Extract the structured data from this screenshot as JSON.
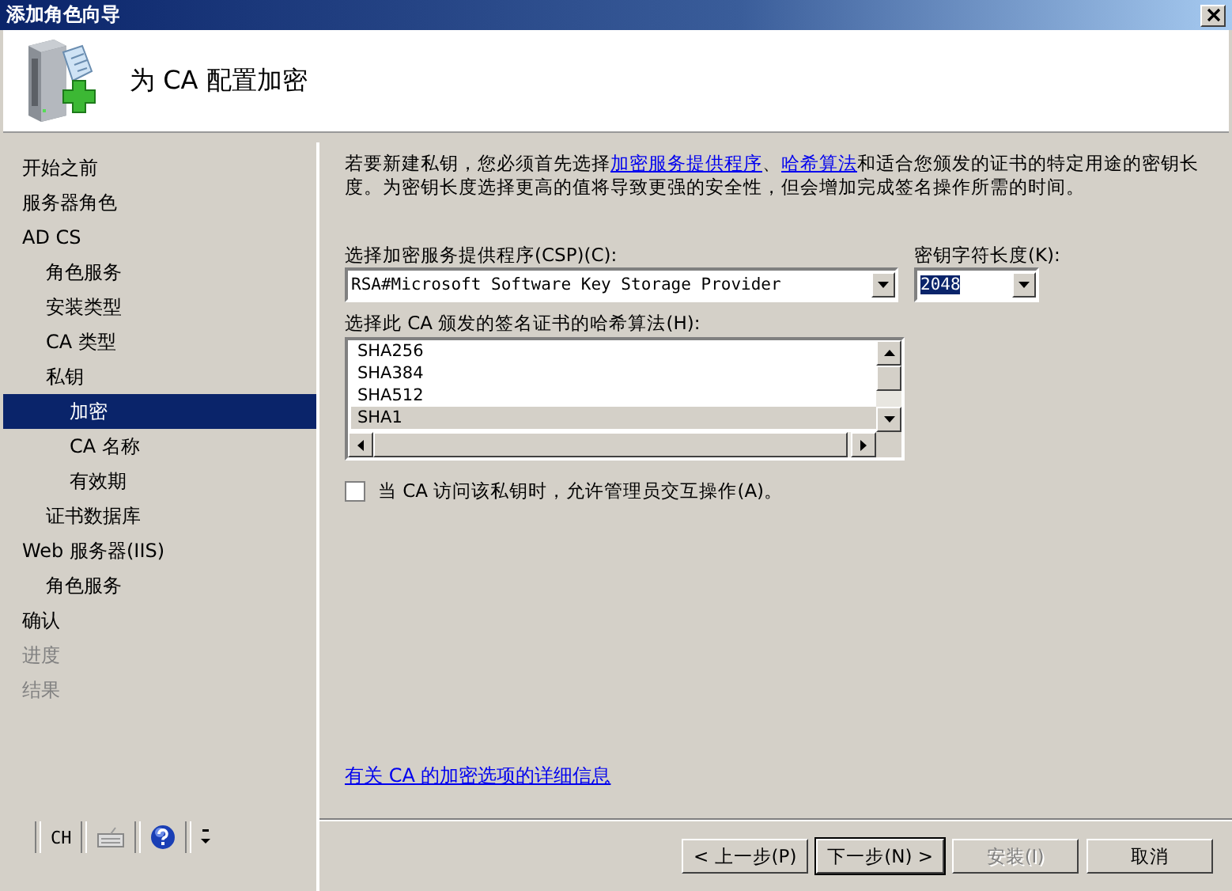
{
  "window": {
    "title": "添加角色向导"
  },
  "header": {
    "title": "为 CA 配置加密"
  },
  "sidebar": {
    "items": [
      {
        "label": "开始之前",
        "selected": false,
        "disabled": false
      },
      {
        "label": "服务器角色",
        "selected": false,
        "disabled": false
      },
      {
        "label": "AD CS",
        "selected": false,
        "disabled": false,
        "children": [
          {
            "label": "角色服务",
            "selected": false,
            "disabled": false
          },
          {
            "label": "安装类型",
            "selected": false,
            "disabled": false
          },
          {
            "label": "CA 类型",
            "selected": false,
            "disabled": false
          },
          {
            "label": "私钥",
            "selected": false,
            "disabled": false,
            "children": [
              {
                "label": "加密",
                "selected": true,
                "disabled": false
              },
              {
                "label": "CA 名称",
                "selected": false,
                "disabled": false
              },
              {
                "label": "有效期",
                "selected": false,
                "disabled": false
              }
            ]
          },
          {
            "label": "证书数据库",
            "selected": false,
            "disabled": false
          }
        ]
      },
      {
        "label": "Web 服务器(IIS)",
        "selected": false,
        "disabled": false,
        "children": [
          {
            "label": "角色服务",
            "selected": false,
            "disabled": false
          }
        ]
      },
      {
        "label": "确认",
        "selected": false,
        "disabled": false
      },
      {
        "label": "进度",
        "selected": false,
        "disabled": true
      },
      {
        "label": "结果",
        "selected": false,
        "disabled": true
      }
    ]
  },
  "intro": [
    {
      "kind": "text",
      "text": "若要新建私钥，您必须首先选择"
    },
    {
      "kind": "link",
      "text": "加密服务提供程序"
    },
    {
      "kind": "text",
      "text": "、"
    },
    {
      "kind": "link",
      "text": "哈希算法"
    },
    {
      "kind": "text",
      "text": "和适合您颁发的证书的特定用途的密钥长度。为密钥长度选择更高的值将导致更强的安全性，但会增加完成签名操作所需的时间。"
    }
  ],
  "csp": {
    "label": "选择加密服务提供程序(CSP)(C):",
    "value": "RSA#Microsoft Software Key Storage Provider"
  },
  "key_length": {
    "label": "密钥字符长度(K):",
    "value": "2048"
  },
  "hash": {
    "label": "选择此 CA 颁发的签名证书的哈希算法(H):",
    "items": [
      {
        "label": "SHA256",
        "selected": false
      },
      {
        "label": "SHA384",
        "selected": false
      },
      {
        "label": "SHA512",
        "selected": false
      },
      {
        "label": "SHA1",
        "selected": true
      }
    ]
  },
  "admin_interaction": {
    "label": "当 CA 访问该私钥时，允许管理员交互操作(A)。",
    "checked": false
  },
  "more_info_link": "有关 CA 的加密选项的详细信息",
  "language_bar": {
    "language": "CH"
  },
  "buttons": [
    {
      "label": "< 上一步(P)",
      "disabled": false,
      "default": false
    },
    {
      "label": "下一步(N) >",
      "disabled": false,
      "default": true
    },
    {
      "label": "安装(I)",
      "disabled": true,
      "default": false
    },
    {
      "label": "取消",
      "disabled": false,
      "default": false
    }
  ]
}
